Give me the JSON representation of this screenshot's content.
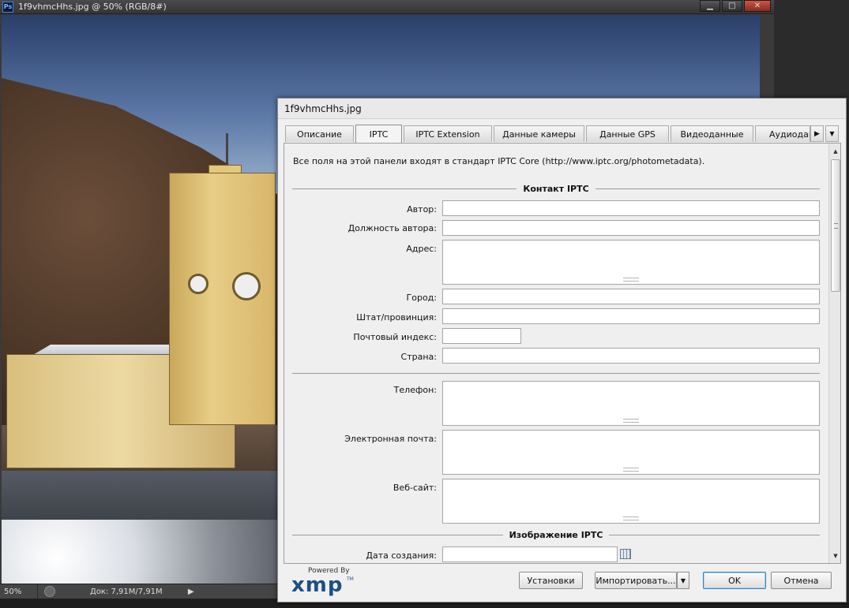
{
  "document": {
    "title": "1f9vhmcHhs.jpg @ 50% (RGB/8#)",
    "app_icon": "Ps",
    "window_controls": {
      "minimize": "▁",
      "maximize": "□",
      "close": "✕"
    },
    "status": {
      "zoom": "50%",
      "doc_info": "Док: 7,91M/7,91M",
      "arrow": "▶"
    }
  },
  "dialog": {
    "title": "1f9vhmcHhs.jpg",
    "tabs": [
      {
        "label": "Описание",
        "active": false
      },
      {
        "label": "IPTC",
        "active": true
      },
      {
        "label": "IPTC Extension",
        "active": false
      },
      {
        "label": "Данные камеры",
        "active": false
      },
      {
        "label": "Данные GPS",
        "active": false
      },
      {
        "label": "Видеоданные",
        "active": false
      },
      {
        "label": "Аудиодан",
        "active": false
      }
    ],
    "tab_scroll_right": "▶",
    "tab_menu": "▼",
    "intro": "Все поля на этой панели входят в стандарт IPTC Core (http://www.iptc.org/photometadata).",
    "sections": {
      "contact": "Контакт IPTC",
      "image": "Изображение IPTC"
    },
    "fields": {
      "author": {
        "label": "Автор:",
        "value": ""
      },
      "author_title": {
        "label": "Должность автора:",
        "value": ""
      },
      "address": {
        "label": "Адрес:",
        "value": ""
      },
      "city": {
        "label": "Город:",
        "value": ""
      },
      "state": {
        "label": "Штат/провинция:",
        "value": ""
      },
      "postal": {
        "label": "Почтовый индекс:",
        "value": ""
      },
      "country": {
        "label": "Страна:",
        "value": ""
      },
      "phone": {
        "label": "Телефон:",
        "value": ""
      },
      "email": {
        "label": "Электронная почта:",
        "value": ""
      },
      "website": {
        "label": "Веб-сайт:",
        "value": ""
      },
      "date_created": {
        "label": "Дата создания:",
        "value": ""
      }
    },
    "scroll": {
      "up": "▲",
      "down": "▼"
    },
    "logo": {
      "powered_by": "Powered By",
      "xmp": "xmp",
      "tm": "TM"
    },
    "buttons": {
      "settings": "Установки",
      "import": "Импортировать...",
      "import_arrow": "▼",
      "ok": "OK",
      "cancel": "Отмена"
    }
  }
}
